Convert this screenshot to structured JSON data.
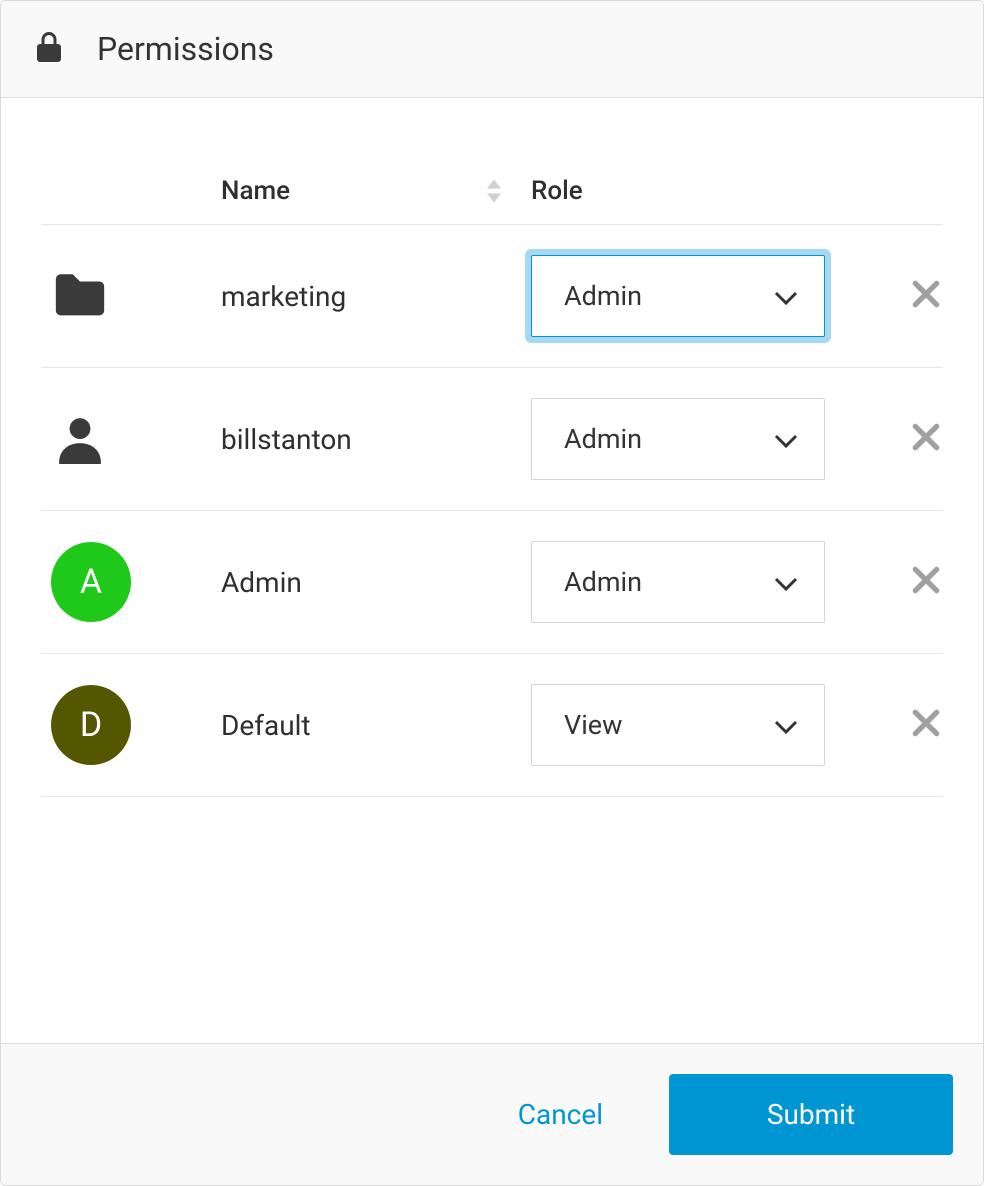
{
  "header": {
    "title": "Permissions"
  },
  "table": {
    "columns": {
      "name": "Name",
      "role": "Role"
    },
    "rows": [
      {
        "icon_type": "folder",
        "name": "marketing",
        "role": "Admin",
        "focused": true
      },
      {
        "icon_type": "user",
        "name": "billstanton",
        "role": "Admin",
        "focused": false
      },
      {
        "icon_type": "avatar",
        "avatar_letter": "A",
        "avatar_color": "#1ec919",
        "name": "Admin",
        "role": "Admin",
        "focused": false
      },
      {
        "icon_type": "avatar",
        "avatar_letter": "D",
        "avatar_color": "#545700",
        "name": "Default",
        "role": "View",
        "focused": false
      }
    ]
  },
  "footer": {
    "cancel": "Cancel",
    "submit": "Submit"
  }
}
